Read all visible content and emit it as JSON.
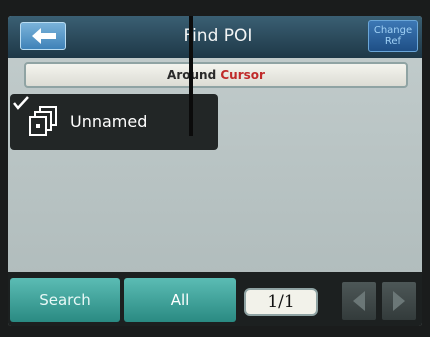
{
  "header": {
    "title": "Find POI",
    "change_ref_line1": "Change",
    "change_ref_line2": "Ref",
    "back_icon": "back-arrow-icon"
  },
  "reference": {
    "prefix": "Around",
    "highlight": "Cursor"
  },
  "poi_list": [
    {
      "label": "Unnamed",
      "selected": true,
      "icon": "pages-icon"
    }
  ],
  "footer": {
    "search_label": "Search",
    "all_label": "All",
    "page_indicator": "1/1",
    "prev_icon": "left-arrow-icon",
    "next_icon": "right-arrow-icon"
  },
  "colors": {
    "accent": "#2a8a82",
    "highlight_text": "#c02a2a",
    "header_bg": "#1e3847"
  }
}
